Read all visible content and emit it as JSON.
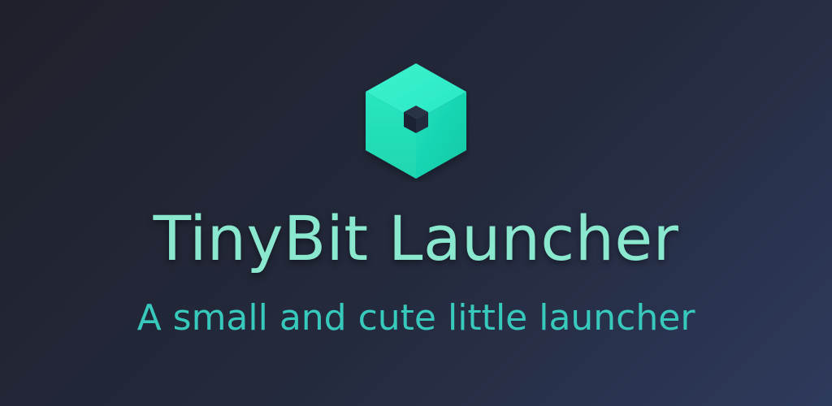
{
  "app": {
    "title": "TinyBit Launcher",
    "tagline": "A small and cute little launcher"
  },
  "logo": {
    "icon": "cube-icon"
  },
  "colors": {
    "background_start": "#1f202b",
    "background_end": "#2e3a5c",
    "title": "#8ae8cf",
    "tagline": "#38c9bd",
    "cube_light": "#2ff0c8",
    "cube_mid": "#1fe0bd",
    "cube_dark": "#13c9a8",
    "cube_core": "#1d2536"
  }
}
